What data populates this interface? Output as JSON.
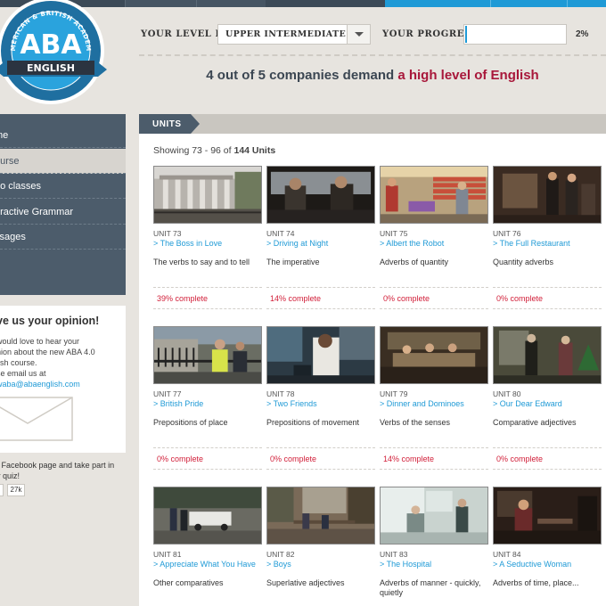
{
  "logo": {
    "ring_text": "AMERICAN & BRITISH ACADEMY",
    "main": "ABA",
    "sub": "ENGLISH"
  },
  "level_bar": {
    "level_label": "YOUR LEVEL IS:",
    "level_value": "UPPER INTERMEDIATE",
    "progress_label": "YOUR PROGRESS:",
    "progress_percent": 2,
    "progress_text": "2%"
  },
  "headline": {
    "prefix": "4 out of 5 companies demand ",
    "accent": "a high level of English"
  },
  "sidebar": {
    "items": [
      {
        "label": "me",
        "active": false
      },
      {
        "label": "ourse",
        "active": true
      },
      {
        "label": "eo classes",
        "active": false
      },
      {
        "label": "eractive Grammar",
        "active": false
      },
      {
        "label": "ssages",
        "active": false
      }
    ],
    "opinion": {
      "title": "ve us your opinion!",
      "line1": " would love to hear your",
      "line2": "nion about the new ABA 4.0",
      "line3": "lish course.",
      "line4": "se email us at",
      "email": "waba@abaenglish.com"
    },
    "facebook": {
      "line1": "r Facebook page and take part in",
      "line2": "y quiz!",
      "count": "27k"
    }
  },
  "units": {
    "tab_label": "UNITS",
    "showing_prefix": "Showing 73 - 96 of ",
    "showing_total": "144 Units",
    "cards": [
      {
        "num": "UNIT 73",
        "title": "> The Boss in Love",
        "desc": "The verbs to say and to tell",
        "pct": "39% complete",
        "thumb": "columns"
      },
      {
        "num": "UNIT 74",
        "title": "> Driving at Night",
        "desc": "The imperative",
        "pct": "14% complete",
        "thumb": "car"
      },
      {
        "num": "UNIT 75",
        "title": "> Albert the Robot",
        "desc": "Adverbs of quantity",
        "pct": "0% complete",
        "thumb": "shop"
      },
      {
        "num": "UNIT 76",
        "title": "> The Full Restaurant",
        "desc": "Quantity adverbs",
        "pct": "0% complete",
        "thumb": "restaurant"
      },
      {
        "num": "UNIT 77",
        "title": "> British Pride",
        "desc": "Prepositions of place",
        "pct": "0% complete",
        "thumb": "police"
      },
      {
        "num": "UNIT 78",
        "title": "> Two Friends",
        "desc": "Prepositions of movement",
        "pct": "0% complete",
        "thumb": "phone"
      },
      {
        "num": "UNIT 79",
        "title": "> Dinner and Dominoes",
        "desc": "Verbs of the senses",
        "pct": "14% complete",
        "thumb": "dinner"
      },
      {
        "num": "UNIT 80",
        "title": "> Our Dear Edward",
        "desc": "Comparative adjectives",
        "pct": "0% complete",
        "thumb": "room"
      },
      {
        "num": "UNIT 81",
        "title": "> Appreciate What You Have",
        "desc": "Other comparatives",
        "pct": "",
        "thumb": "street"
      },
      {
        "num": "UNIT 82",
        "title": "> Boys",
        "desc": "Superlative adjectives",
        "pct": "",
        "thumb": "square"
      },
      {
        "num": "UNIT 83",
        "title": "> The Hospital",
        "desc": "Adverbs of manner - quickly, quietly",
        "pct": "",
        "thumb": "hospital"
      },
      {
        "num": "UNIT 84",
        "title": "> A Seductive Woman",
        "desc": "Adverbs of time, place...",
        "pct": "",
        "thumb": "bar"
      }
    ]
  },
  "colors": {
    "accent_blue": "#1f9ad6",
    "accent_red": "#a8173a",
    "percent_red": "#d2203a",
    "slate": "#4c5c6b"
  }
}
